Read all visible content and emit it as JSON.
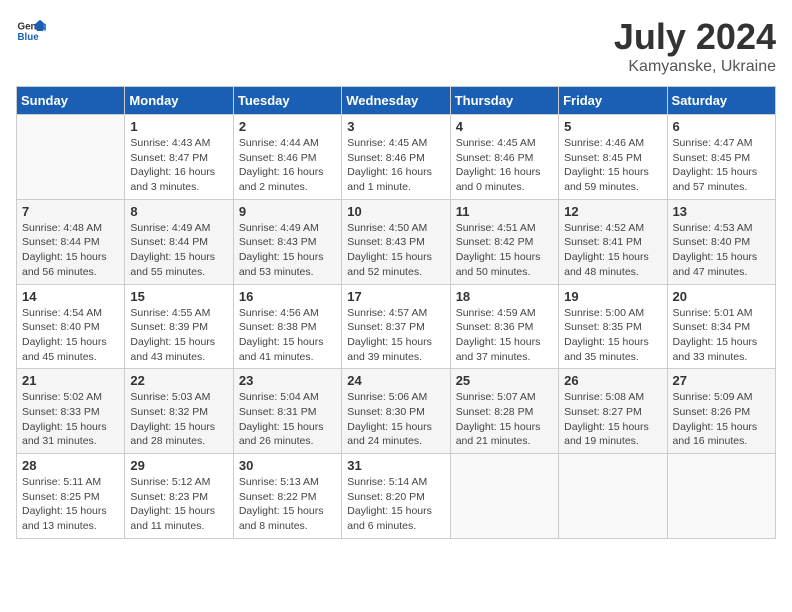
{
  "header": {
    "logo_general": "General",
    "logo_blue": "Blue",
    "month_title": "July 2024",
    "subtitle": "Kamyanske, Ukraine"
  },
  "days_of_week": [
    "Sunday",
    "Monday",
    "Tuesday",
    "Wednesday",
    "Thursday",
    "Friday",
    "Saturday"
  ],
  "weeks": [
    [
      {
        "day": "",
        "info": ""
      },
      {
        "day": "1",
        "info": "Sunrise: 4:43 AM\nSunset: 8:47 PM\nDaylight: 16 hours\nand 3 minutes."
      },
      {
        "day": "2",
        "info": "Sunrise: 4:44 AM\nSunset: 8:46 PM\nDaylight: 16 hours\nand 2 minutes."
      },
      {
        "day": "3",
        "info": "Sunrise: 4:45 AM\nSunset: 8:46 PM\nDaylight: 16 hours\nand 1 minute."
      },
      {
        "day": "4",
        "info": "Sunrise: 4:45 AM\nSunset: 8:46 PM\nDaylight: 16 hours\nand 0 minutes."
      },
      {
        "day": "5",
        "info": "Sunrise: 4:46 AM\nSunset: 8:45 PM\nDaylight: 15 hours\nand 59 minutes."
      },
      {
        "day": "6",
        "info": "Sunrise: 4:47 AM\nSunset: 8:45 PM\nDaylight: 15 hours\nand 57 minutes."
      }
    ],
    [
      {
        "day": "7",
        "info": "Sunrise: 4:48 AM\nSunset: 8:44 PM\nDaylight: 15 hours\nand 56 minutes."
      },
      {
        "day": "8",
        "info": "Sunrise: 4:49 AM\nSunset: 8:44 PM\nDaylight: 15 hours\nand 55 minutes."
      },
      {
        "day": "9",
        "info": "Sunrise: 4:49 AM\nSunset: 8:43 PM\nDaylight: 15 hours\nand 53 minutes."
      },
      {
        "day": "10",
        "info": "Sunrise: 4:50 AM\nSunset: 8:43 PM\nDaylight: 15 hours\nand 52 minutes."
      },
      {
        "day": "11",
        "info": "Sunrise: 4:51 AM\nSunset: 8:42 PM\nDaylight: 15 hours\nand 50 minutes."
      },
      {
        "day": "12",
        "info": "Sunrise: 4:52 AM\nSunset: 8:41 PM\nDaylight: 15 hours\nand 48 minutes."
      },
      {
        "day": "13",
        "info": "Sunrise: 4:53 AM\nSunset: 8:40 PM\nDaylight: 15 hours\nand 47 minutes."
      }
    ],
    [
      {
        "day": "14",
        "info": "Sunrise: 4:54 AM\nSunset: 8:40 PM\nDaylight: 15 hours\nand 45 minutes."
      },
      {
        "day": "15",
        "info": "Sunrise: 4:55 AM\nSunset: 8:39 PM\nDaylight: 15 hours\nand 43 minutes."
      },
      {
        "day": "16",
        "info": "Sunrise: 4:56 AM\nSunset: 8:38 PM\nDaylight: 15 hours\nand 41 minutes."
      },
      {
        "day": "17",
        "info": "Sunrise: 4:57 AM\nSunset: 8:37 PM\nDaylight: 15 hours\nand 39 minutes."
      },
      {
        "day": "18",
        "info": "Sunrise: 4:59 AM\nSunset: 8:36 PM\nDaylight: 15 hours\nand 37 minutes."
      },
      {
        "day": "19",
        "info": "Sunrise: 5:00 AM\nSunset: 8:35 PM\nDaylight: 15 hours\nand 35 minutes."
      },
      {
        "day": "20",
        "info": "Sunrise: 5:01 AM\nSunset: 8:34 PM\nDaylight: 15 hours\nand 33 minutes."
      }
    ],
    [
      {
        "day": "21",
        "info": "Sunrise: 5:02 AM\nSunset: 8:33 PM\nDaylight: 15 hours\nand 31 minutes."
      },
      {
        "day": "22",
        "info": "Sunrise: 5:03 AM\nSunset: 8:32 PM\nDaylight: 15 hours\nand 28 minutes."
      },
      {
        "day": "23",
        "info": "Sunrise: 5:04 AM\nSunset: 8:31 PM\nDaylight: 15 hours\nand 26 minutes."
      },
      {
        "day": "24",
        "info": "Sunrise: 5:06 AM\nSunset: 8:30 PM\nDaylight: 15 hours\nand 24 minutes."
      },
      {
        "day": "25",
        "info": "Sunrise: 5:07 AM\nSunset: 8:28 PM\nDaylight: 15 hours\nand 21 minutes."
      },
      {
        "day": "26",
        "info": "Sunrise: 5:08 AM\nSunset: 8:27 PM\nDaylight: 15 hours\nand 19 minutes."
      },
      {
        "day": "27",
        "info": "Sunrise: 5:09 AM\nSunset: 8:26 PM\nDaylight: 15 hours\nand 16 minutes."
      }
    ],
    [
      {
        "day": "28",
        "info": "Sunrise: 5:11 AM\nSunset: 8:25 PM\nDaylight: 15 hours\nand 13 minutes."
      },
      {
        "day": "29",
        "info": "Sunrise: 5:12 AM\nSunset: 8:23 PM\nDaylight: 15 hours\nand 11 minutes."
      },
      {
        "day": "30",
        "info": "Sunrise: 5:13 AM\nSunset: 8:22 PM\nDaylight: 15 hours\nand 8 minutes."
      },
      {
        "day": "31",
        "info": "Sunrise: 5:14 AM\nSunset: 8:20 PM\nDaylight: 15 hours\nand 6 minutes."
      },
      {
        "day": "",
        "info": ""
      },
      {
        "day": "",
        "info": ""
      },
      {
        "day": "",
        "info": ""
      }
    ]
  ]
}
